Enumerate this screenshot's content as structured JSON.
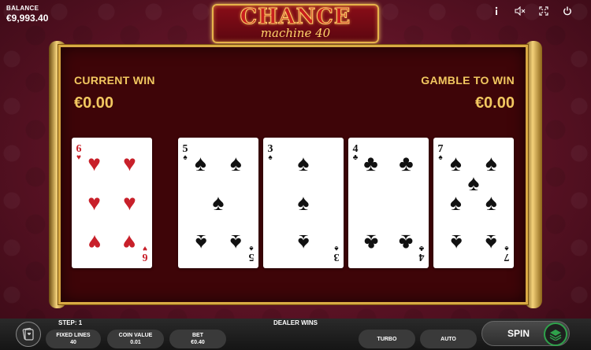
{
  "balance": {
    "label": "BALANCE",
    "value": "€9,993.40"
  },
  "logo": {
    "line1": "CHANCE",
    "line2": "machine 40"
  },
  "top_icons": [
    "info-icon",
    "mute-icon",
    "fullscreen-icon",
    "power-icon"
  ],
  "board": {
    "current_win_label": "CURRENT WIN",
    "current_win_value": "€0.00",
    "gamble_label": "GAMBLE TO WIN",
    "gamble_value": "€0.00"
  },
  "cards": [
    {
      "rank": "6",
      "suit": "♥",
      "color": "red"
    },
    {
      "rank": "5",
      "suit": "♠",
      "color": "black"
    },
    {
      "rank": "3",
      "suit": "♠",
      "color": "black"
    },
    {
      "rank": "4",
      "suit": "♣",
      "color": "black"
    },
    {
      "rank": "7",
      "suit": "♠",
      "color": "black"
    }
  ],
  "footer": {
    "step": "STEP: 1",
    "dealer": "DEALER WINS",
    "fixed_lines_label": "FIXED LINES",
    "fixed_lines_value": "40",
    "coin_value_label": "COIN VALUE",
    "coin_value_value": "0.01",
    "bet_label": "BET",
    "bet_value": "€0.40",
    "turbo": "TURBO",
    "auto": "AUTO",
    "spin": "SPIN"
  },
  "colors": {
    "gold": "#f2c860",
    "felt": "#3e0508",
    "spin_accent": "#2fa24b"
  }
}
